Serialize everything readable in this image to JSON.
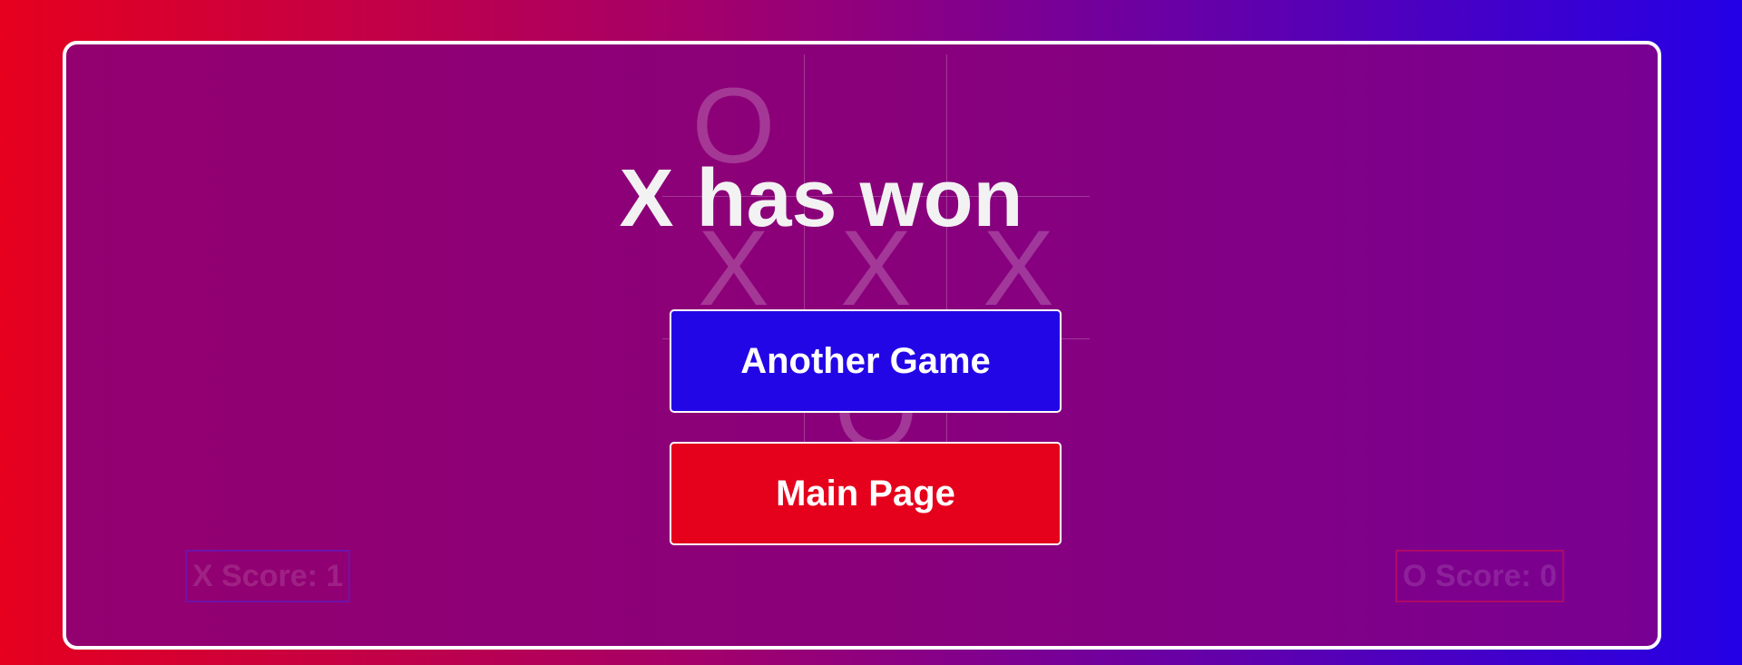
{
  "board": {
    "cells": [
      "O",
      "",
      "",
      "X",
      "X",
      "X",
      "",
      "O",
      ""
    ]
  },
  "result_text": "X has won",
  "buttons": {
    "another_game": "Another Game",
    "main_page": "Main Page"
  },
  "scores": {
    "x": "X Score: 1",
    "o": "O Score: 0"
  },
  "colors": {
    "background_left": "#e6001e",
    "background_right": "#2400e6",
    "another_game_button": "#2306e6",
    "main_page_button": "#e5001c"
  }
}
